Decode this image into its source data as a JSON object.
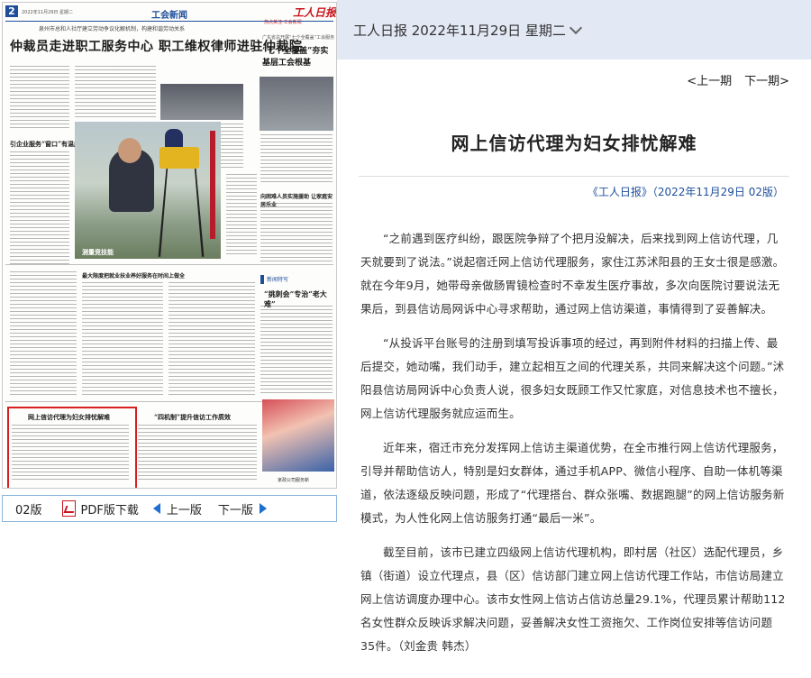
{
  "paper": {
    "page_number": "2",
    "date_line": "2022年11月29日 星期二",
    "section": "工会新闻",
    "flag": "工人日报",
    "flag_sub": "热点关注·工会新闻",
    "kicker": "泉州市总和人社厅建立劳动争议化解机制，构建和谐劳动关系",
    "main_headline": "仲裁员走进职工服务中心  职工维权律师进驻仲裁院",
    "side_kicker": "广东省总开展“七个全覆盖”工会服务",
    "side_headline": "“七个全覆盖”夯实基层工会根基",
    "story2_head": "引企业服务“窗口”有温度",
    "photo_caption": "测量竞技能",
    "story3_head": "向困难人员实施援助 让家庭安居乐业",
    "story4_head": "最大限度把就业扶业养好服务在时间上做全",
    "new_feature_label": "新闻特写",
    "story5_head": "“挑刺会”专治“老大难”",
    "redbox_head": "网上信访代理为妇女排忧解难",
    "story6_head": "“四机制”提升信访工作质效",
    "photo_small_caption": "家政公司服务新"
  },
  "pagenav": {
    "page": "02版",
    "pdf": "PDF版下载",
    "prev": "上一版",
    "next": "下一版"
  },
  "topbar": {
    "issue": "工人日报 2022年11月29日 星期二"
  },
  "prevnext": {
    "prev": "<上一期",
    "next": "下一期>"
  },
  "article": {
    "title": "网上信访代理为妇女排忧解难",
    "source": "《工人日报》（2022年11月29日 02版）",
    "paragraphs": [
      "“之前遇到医疗纠纷，跟医院争辩了个把月没解决，后来找到网上信访代理，几天就要到了说法。”说起宿迁网上信访代理服务，家住江苏沭阳县的王女士很是感激。就在今年9月，她带母亲做肠胃镜检查时不幸发生医疗事故，多次向医院讨要说法无果后，到县信访局网诉中心寻求帮助，通过网上信访渠道，事情得到了妥善解决。",
      "“从投诉平台账号的注册到填写投诉事项的经过，再到附件材料的扫描上传、最后提交，她动嘴，我们动手，建立起相互之间的代理关系，共同来解决这个问题。”沭阳县信访局网诉中心负责人说，很多妇女既顾工作又忙家庭，对信息技术也不擅长，网上信访代理服务就应运而生。",
      "近年来，宿迁市充分发挥网上信访主渠道优势，在全市推行网上信访代理服务，引导并帮助信访人，特别是妇女群体，通过手机APP、微信小程序、自助一体机等渠道，依法逐级反映问题，形成了“代理搭台、群众张嘴、数据跑腿”的网上信访服务新模式，为人性化网上信访服务打通“最后一米”。",
      "截至目前，该市已建立四级网上信访代理机构，即村居（社区）选配代理员，乡镇（街道）设立代理点，县（区）信访部门建立网上信访代理工作站，市信访局建立网上信访调度办理中心。该市女性网上信访占信访总量29.1%，代理员累计帮助112名女性群众反映诉求解决问题，妥善解决女性工资拖欠、工作岗位安排等信访问题35件。（刘金贵 韩杰）"
    ]
  },
  "colors": {
    "brand_blue": "#1e4f9c",
    "highlight_red": "#d81e1e",
    "topbar_bg": "#e2e8f4"
  }
}
